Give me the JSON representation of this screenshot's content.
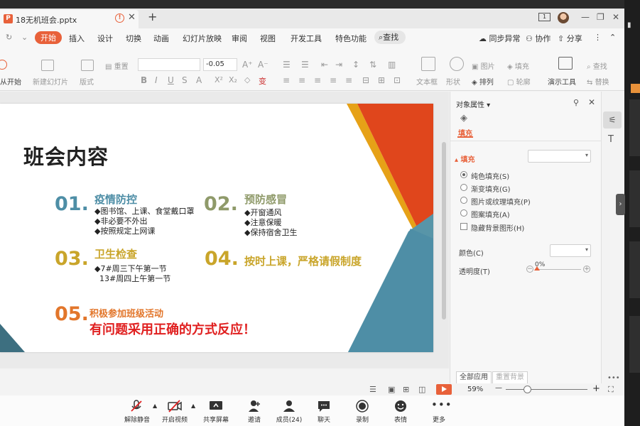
{
  "tabbar": {
    "doc_title": "18无机班会.pptx",
    "doc_icon": "P",
    "warn_symbol": "!",
    "close_symbol": "✕",
    "add_symbol": "+",
    "badge": "1",
    "minimize": "—",
    "restore": "❐",
    "close_window": "✕"
  },
  "menu": {
    "items": [
      "开始",
      "插入",
      "设计",
      "切换",
      "动画",
      "幻灯片放映",
      "审阅",
      "视图",
      "开发工具",
      "特色功能"
    ],
    "search": "查找",
    "sync": "同步异常",
    "collab": "协作",
    "share": "分享",
    "more": "⋮"
  },
  "ribbon": {
    "start_from": "从开始",
    "new_slide": "新建幻灯片",
    "layout": "版式",
    "reset": "重置",
    "font_size": "-0.05",
    "textbox": "文本框",
    "shape": "形状",
    "picture": "图片",
    "fill": "填充",
    "arrange": "排列",
    "outline": "轮廓",
    "present_tools": "演示工具",
    "find": "查找",
    "replace": "替换"
  },
  "slide": {
    "title": "班会内容",
    "items": [
      {
        "num": "01.",
        "head": "疫情防控",
        "bullets": "◆图书馆、上课、食堂戴口罩\n◆非必要不外出\n◆按照规定上网课"
      },
      {
        "num": "02.",
        "head": "预防感冒",
        "bullets": "◆开窗通风\n◆注意保暖\n◆保持宿舍卫生"
      },
      {
        "num": "03.",
        "head": "卫生检查",
        "bullets": "◆7#周三下午第一节\n  13#周四上午第一节"
      },
      {
        "num": "04.",
        "head": "按时上课，严格请假制度",
        "bullets": ""
      },
      {
        "num": "05.",
        "head": "积极参加班级活动",
        "bullets": ""
      }
    ],
    "footer": "有问题采用正确的方式反应！"
  },
  "panel": {
    "title": "对象属性",
    "fill_tab": "填充",
    "fill_section": "填充",
    "options": [
      "纯色填充(S)",
      "渐变填充(G)",
      "图片或纹理填充(P)",
      "图案填充(A)"
    ],
    "hide_bg": "隐藏背景图形(H)",
    "color_label": "颜色(C)",
    "transparency_label": "透明度(T)",
    "transparency_value": "0%",
    "apply_all": "全部应用",
    "reset_bg": "重置背景"
  },
  "statusbar": {
    "zoom": "59%",
    "zoom_minus": "—",
    "zoom_plus": "+"
  },
  "meeting": {
    "buttons": [
      "解除静音",
      "开启视频",
      "共享屏幕",
      "邀请",
      "成员(24)",
      "聊天",
      "录制",
      "表情",
      "更多"
    ]
  },
  "colors": {
    "accent": "#e8613a",
    "slide_orange": "#e0461c",
    "slide_gold": "#e6a117",
    "slide_teal": "#4e8ea6"
  }
}
